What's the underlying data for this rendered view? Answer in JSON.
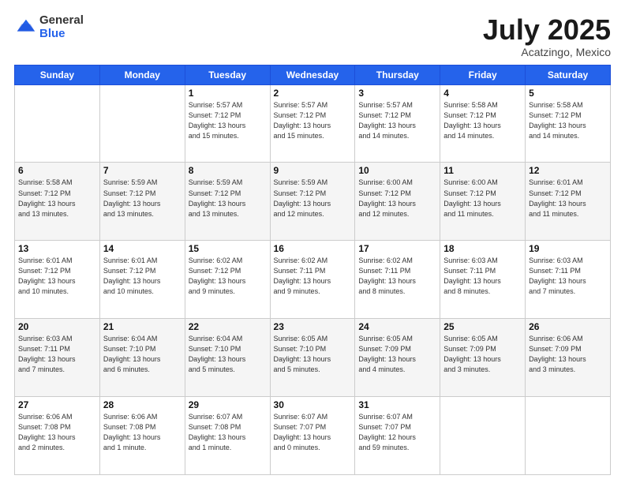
{
  "header": {
    "logo_general": "General",
    "logo_blue": "Blue",
    "month_title": "July 2025",
    "subtitle": "Acatzingo, Mexico"
  },
  "weekdays": [
    "Sunday",
    "Monday",
    "Tuesday",
    "Wednesday",
    "Thursday",
    "Friday",
    "Saturday"
  ],
  "weeks": [
    [
      {
        "day": "",
        "info": ""
      },
      {
        "day": "",
        "info": ""
      },
      {
        "day": "1",
        "info": "Sunrise: 5:57 AM\nSunset: 7:12 PM\nDaylight: 13 hours\nand 15 minutes."
      },
      {
        "day": "2",
        "info": "Sunrise: 5:57 AM\nSunset: 7:12 PM\nDaylight: 13 hours\nand 15 minutes."
      },
      {
        "day": "3",
        "info": "Sunrise: 5:57 AM\nSunset: 7:12 PM\nDaylight: 13 hours\nand 14 minutes."
      },
      {
        "day": "4",
        "info": "Sunrise: 5:58 AM\nSunset: 7:12 PM\nDaylight: 13 hours\nand 14 minutes."
      },
      {
        "day": "5",
        "info": "Sunrise: 5:58 AM\nSunset: 7:12 PM\nDaylight: 13 hours\nand 14 minutes."
      }
    ],
    [
      {
        "day": "6",
        "info": "Sunrise: 5:58 AM\nSunset: 7:12 PM\nDaylight: 13 hours\nand 13 minutes."
      },
      {
        "day": "7",
        "info": "Sunrise: 5:59 AM\nSunset: 7:12 PM\nDaylight: 13 hours\nand 13 minutes."
      },
      {
        "day": "8",
        "info": "Sunrise: 5:59 AM\nSunset: 7:12 PM\nDaylight: 13 hours\nand 13 minutes."
      },
      {
        "day": "9",
        "info": "Sunrise: 5:59 AM\nSunset: 7:12 PM\nDaylight: 13 hours\nand 12 minutes."
      },
      {
        "day": "10",
        "info": "Sunrise: 6:00 AM\nSunset: 7:12 PM\nDaylight: 13 hours\nand 12 minutes."
      },
      {
        "day": "11",
        "info": "Sunrise: 6:00 AM\nSunset: 7:12 PM\nDaylight: 13 hours\nand 11 minutes."
      },
      {
        "day": "12",
        "info": "Sunrise: 6:01 AM\nSunset: 7:12 PM\nDaylight: 13 hours\nand 11 minutes."
      }
    ],
    [
      {
        "day": "13",
        "info": "Sunrise: 6:01 AM\nSunset: 7:12 PM\nDaylight: 13 hours\nand 10 minutes."
      },
      {
        "day": "14",
        "info": "Sunrise: 6:01 AM\nSunset: 7:12 PM\nDaylight: 13 hours\nand 10 minutes."
      },
      {
        "day": "15",
        "info": "Sunrise: 6:02 AM\nSunset: 7:12 PM\nDaylight: 13 hours\nand 9 minutes."
      },
      {
        "day": "16",
        "info": "Sunrise: 6:02 AM\nSunset: 7:11 PM\nDaylight: 13 hours\nand 9 minutes."
      },
      {
        "day": "17",
        "info": "Sunrise: 6:02 AM\nSunset: 7:11 PM\nDaylight: 13 hours\nand 8 minutes."
      },
      {
        "day": "18",
        "info": "Sunrise: 6:03 AM\nSunset: 7:11 PM\nDaylight: 13 hours\nand 8 minutes."
      },
      {
        "day": "19",
        "info": "Sunrise: 6:03 AM\nSunset: 7:11 PM\nDaylight: 13 hours\nand 7 minutes."
      }
    ],
    [
      {
        "day": "20",
        "info": "Sunrise: 6:03 AM\nSunset: 7:11 PM\nDaylight: 13 hours\nand 7 minutes."
      },
      {
        "day": "21",
        "info": "Sunrise: 6:04 AM\nSunset: 7:10 PM\nDaylight: 13 hours\nand 6 minutes."
      },
      {
        "day": "22",
        "info": "Sunrise: 6:04 AM\nSunset: 7:10 PM\nDaylight: 13 hours\nand 5 minutes."
      },
      {
        "day": "23",
        "info": "Sunrise: 6:05 AM\nSunset: 7:10 PM\nDaylight: 13 hours\nand 5 minutes."
      },
      {
        "day": "24",
        "info": "Sunrise: 6:05 AM\nSunset: 7:09 PM\nDaylight: 13 hours\nand 4 minutes."
      },
      {
        "day": "25",
        "info": "Sunrise: 6:05 AM\nSunset: 7:09 PM\nDaylight: 13 hours\nand 3 minutes."
      },
      {
        "day": "26",
        "info": "Sunrise: 6:06 AM\nSunset: 7:09 PM\nDaylight: 13 hours\nand 3 minutes."
      }
    ],
    [
      {
        "day": "27",
        "info": "Sunrise: 6:06 AM\nSunset: 7:08 PM\nDaylight: 13 hours\nand 2 minutes."
      },
      {
        "day": "28",
        "info": "Sunrise: 6:06 AM\nSunset: 7:08 PM\nDaylight: 13 hours\nand 1 minute."
      },
      {
        "day": "29",
        "info": "Sunrise: 6:07 AM\nSunset: 7:08 PM\nDaylight: 13 hours\nand 1 minute."
      },
      {
        "day": "30",
        "info": "Sunrise: 6:07 AM\nSunset: 7:07 PM\nDaylight: 13 hours\nand 0 minutes."
      },
      {
        "day": "31",
        "info": "Sunrise: 6:07 AM\nSunset: 7:07 PM\nDaylight: 12 hours\nand 59 minutes."
      },
      {
        "day": "",
        "info": ""
      },
      {
        "day": "",
        "info": ""
      }
    ]
  ]
}
